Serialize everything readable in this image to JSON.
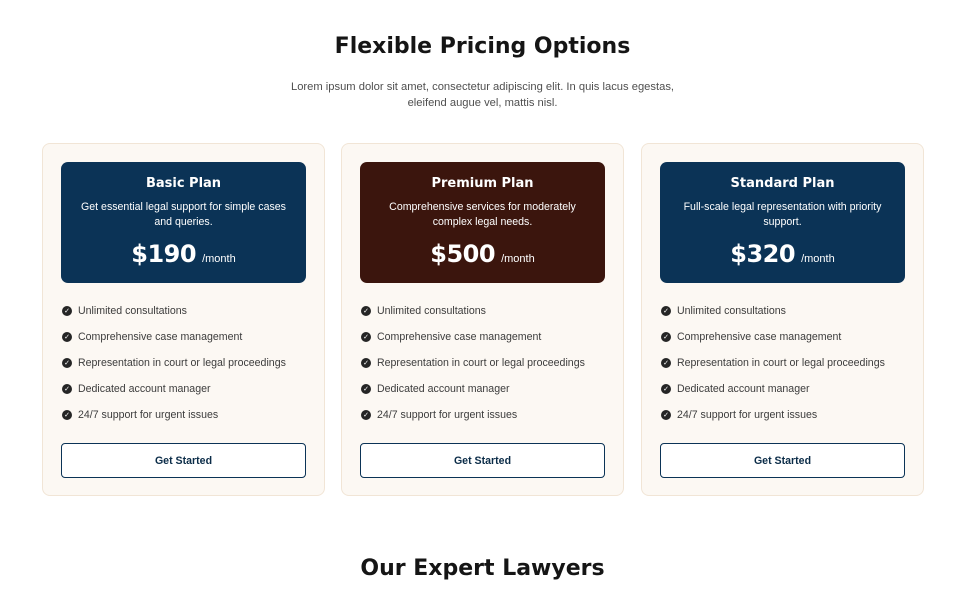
{
  "pricing": {
    "title": "Flexible Pricing Options",
    "subtitle": "Lorem ipsum dolor sit amet, consectetur adipiscing elit. In quis lacus egestas, eleifend augue vel, mattis nisl."
  },
  "plans": [
    {
      "name": "Basic Plan",
      "description": "Get essential legal support for simple cases and queries.",
      "price": "$190",
      "period": "/month",
      "color": "#0b3356",
      "features": [
        "Unlimited consultations",
        "Comprehensive case management",
        "Representation in court or legal proceedings",
        "Dedicated account manager",
        "24/7 support for urgent issues"
      ],
      "cta": "Get Started"
    },
    {
      "name": "Premium Plan",
      "description": "Comprehensive services for moderately complex legal needs.",
      "price": "$500",
      "period": "/month",
      "color": "#3b150d",
      "features": [
        "Unlimited consultations",
        "Comprehensive case management",
        "Representation in court or legal proceedings",
        "Dedicated account manager",
        "24/7 support for urgent issues"
      ],
      "cta": "Get Started"
    },
    {
      "name": "Standard Plan",
      "description": "Full-scale legal representation with priority support.",
      "price": "$320",
      "period": "/month",
      "color": "#0b3356",
      "features": [
        "Unlimited consultations",
        "Comprehensive case management",
        "Representation in court or legal proceedings",
        "Dedicated account manager",
        "24/7 support for urgent issues"
      ],
      "cta": "Get Started"
    }
  ],
  "feature_icon": "check-circle-icon",
  "lawyers": {
    "title": "Our Expert Lawyers"
  }
}
